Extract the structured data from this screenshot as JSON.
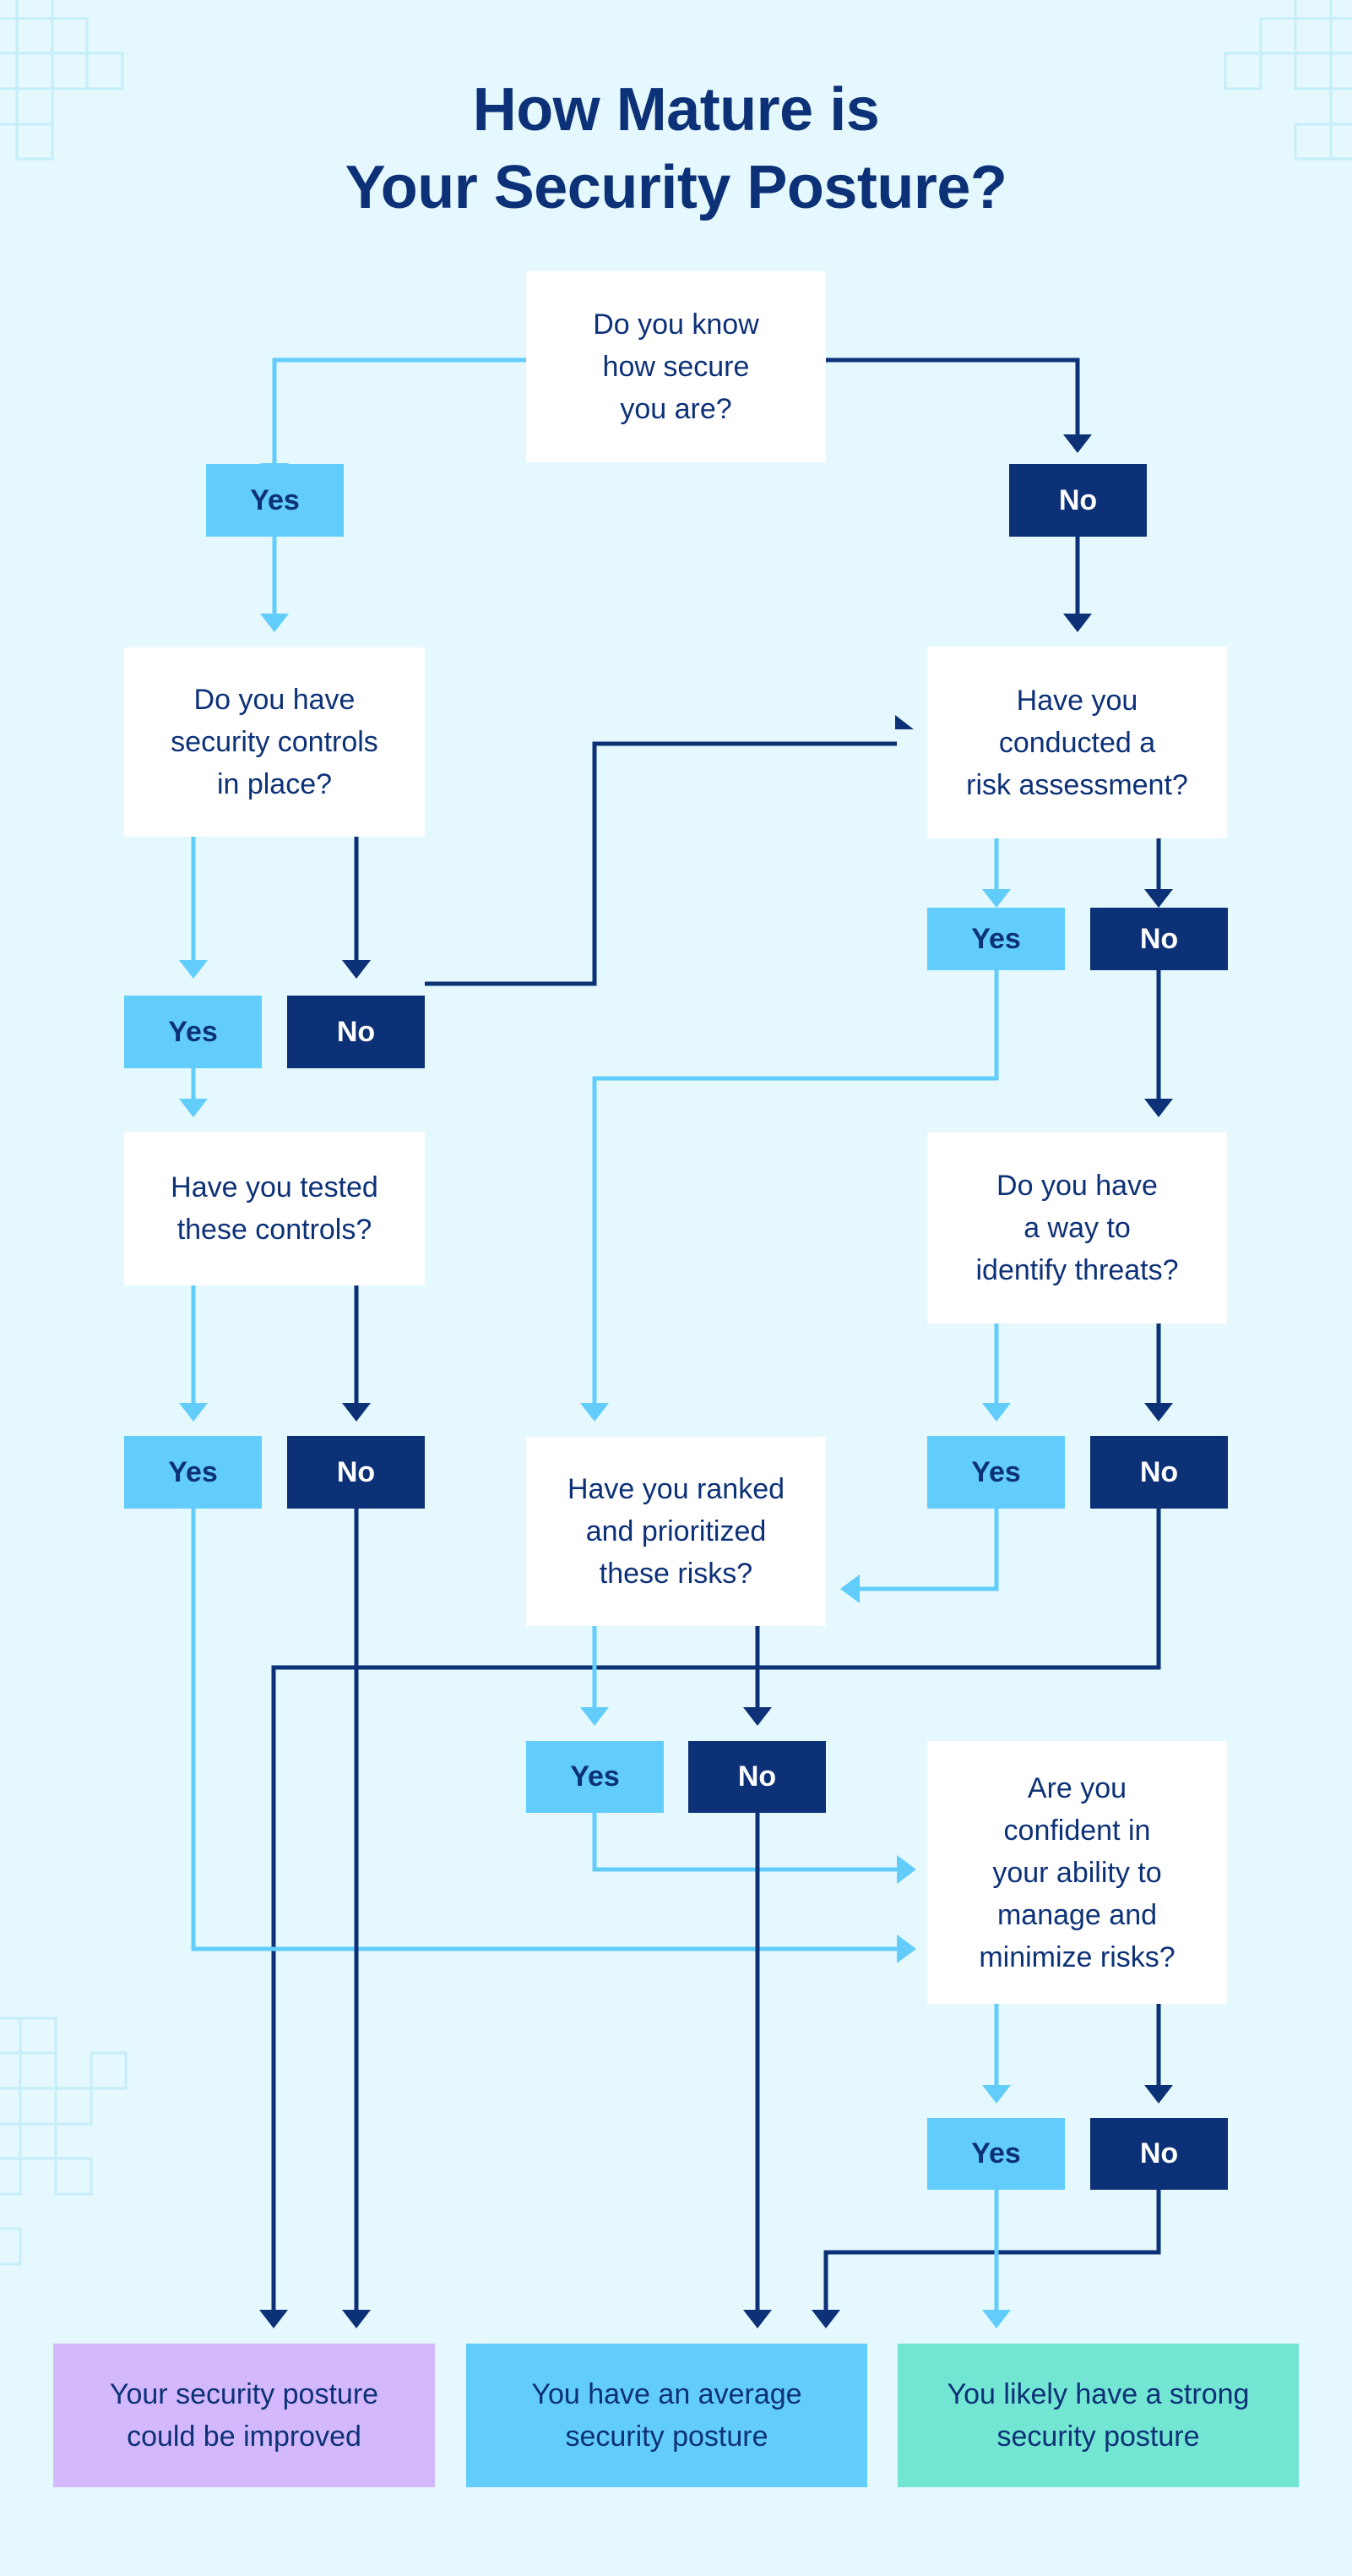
{
  "title": {
    "line1": "How Mature is",
    "line2": "Your Security Posture?"
  },
  "colors": {
    "background": "#E4F8FE",
    "navy": "#0D3177",
    "light_blue": "#62CDFB",
    "decor_grid": "#C6EEF8",
    "result_improve": "#D4B8FD",
    "result_average": "#62CDFB",
    "result_strong": "#72E5D3"
  },
  "questions": {
    "know_secure": [
      "Do you know",
      "how secure",
      "you are?"
    ],
    "security_controls": [
      "Do you have",
      "security controls",
      "in place?"
    ],
    "risk_assessment": [
      "Have you",
      "conducted a",
      "risk assessment?"
    ],
    "tested_controls": [
      "Have you tested",
      "these controls?"
    ],
    "identify_threats": [
      "Do you have",
      "a way to",
      "identify threats?"
    ],
    "ranked_risks": [
      "Have you ranked",
      "and prioritized",
      "these risks?"
    ],
    "confident": [
      "Are you",
      "confident in",
      "your ability to",
      "manage and",
      "minimize risks?"
    ]
  },
  "answers": {
    "yes": "Yes",
    "no": "No"
  },
  "results": {
    "improve": [
      "Your security posture",
      "could be improved"
    ],
    "average": [
      "You have an average",
      "security posture"
    ],
    "strong": [
      "You likely have a strong",
      "security posture"
    ]
  }
}
